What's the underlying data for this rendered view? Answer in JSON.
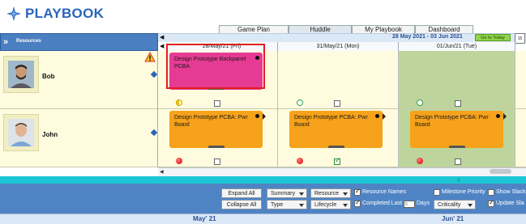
{
  "app": {
    "logo_text": "PLAYBOOK"
  },
  "tabs": [
    {
      "label": "Game Plan"
    },
    {
      "label": "Huddle"
    },
    {
      "label": "My Playbook"
    },
    {
      "label": "Dashboard"
    }
  ],
  "resources_header": {
    "label": "Resources",
    "collapse_icon": "double-chevron-right-icon"
  },
  "timeline": {
    "range": "28 May 2021 - 03 Jun 2021",
    "goto_today": "Go to Today",
    "days": [
      "28/May/21 (Fri)",
      "31/May/21 (Mon)",
      "01/Jun/21 (Tue)"
    ]
  },
  "resources": [
    {
      "name": "Bob",
      "tasks": [
        {
          "title": "Design Prototype Backpanel PCBA",
          "color": "#e63b94",
          "selected": true
        }
      ],
      "indicators": [
        "yellow-half",
        "empty-check",
        "green-ring",
        "empty-check",
        "green-ring",
        "empty-check"
      ]
    },
    {
      "name": "John",
      "tasks": [
        {
          "title": "Design Prototype PCBA: Pwr Board",
          "color": "#f6a21a"
        },
        {
          "title": "Design Prototype PCBA: Pwr Board",
          "color": "#f6a21a"
        },
        {
          "title": "Design Prototype PCBA: Pwr Board",
          "color": "#f6a21a"
        }
      ]
    }
  ],
  "toolbar": {
    "expand_all": "Expand All",
    "collapse_all": "Collapse All",
    "summary": "Summary",
    "type": "Type",
    "resource": "Resource",
    "lifecycle": "Lifecycle",
    "resource_names": "Resource Names",
    "completed_last": "Completed Last",
    "completed_days_value": "5",
    "days": "Days",
    "criticality": "Criticality",
    "milestone_priority": "Milestone Priority",
    "show_slack": "Show Slack",
    "update_slack": "Update Sla"
  },
  "months": [
    "May' 21",
    "Jun' 21"
  ],
  "colors": {
    "accent": "#2a65b8",
    "toolbar": "#4f84c4",
    "splitter": "#1cc6d4",
    "today_col": "#bdd59c"
  }
}
